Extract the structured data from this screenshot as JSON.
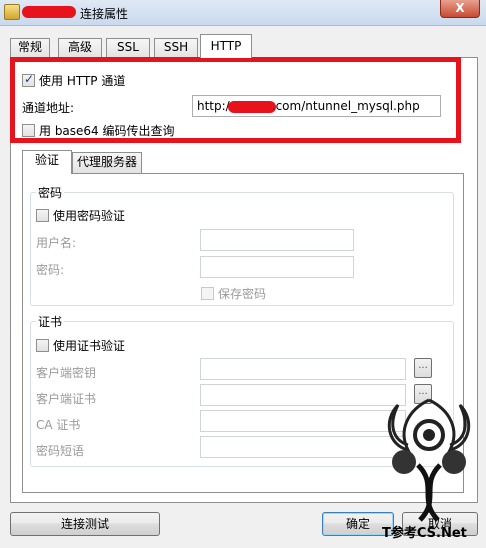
{
  "window": {
    "title": "连接属性",
    "close_label": "X"
  },
  "tabs": [
    {
      "label": "常规"
    },
    {
      "label": "高级"
    },
    {
      "label": "SSL"
    },
    {
      "label": "SSH"
    },
    {
      "label": "HTTP"
    }
  ],
  "http": {
    "use_tunnel_label": "使用 HTTP 通道",
    "use_tunnel_checked": true,
    "tunnel_url_label": "通道地址:",
    "tunnel_url_prefix": "http://",
    "tunnel_url_suffix": ".com/ntunnel_mysql.php",
    "base64_label": "用 base64 编码传出查询",
    "base64_checked": false
  },
  "inner_tabs": [
    {
      "label": "验证"
    },
    {
      "label": "代理服务器"
    }
  ],
  "password_group": {
    "title": "密码",
    "use_password_label": "使用密码验证",
    "username_label": "用户名:",
    "password_label": "密码:",
    "save_password_label": "保存密码"
  },
  "cert_group": {
    "title": "证书",
    "use_cert_label": "使用证书验证",
    "client_key_label": "客户端密钥",
    "client_cert_label": "客户端证书",
    "ca_cert_label": "CA 证书",
    "passphrase_label": "密码短语",
    "browse_label": "..."
  },
  "buttons": {
    "test_connection": "连接测试",
    "ok": "确定",
    "cancel": "取消"
  },
  "watermark": {
    "text": "T参考CS.Net"
  },
  "colors": {
    "highlight_box": "#e8121c"
  }
}
